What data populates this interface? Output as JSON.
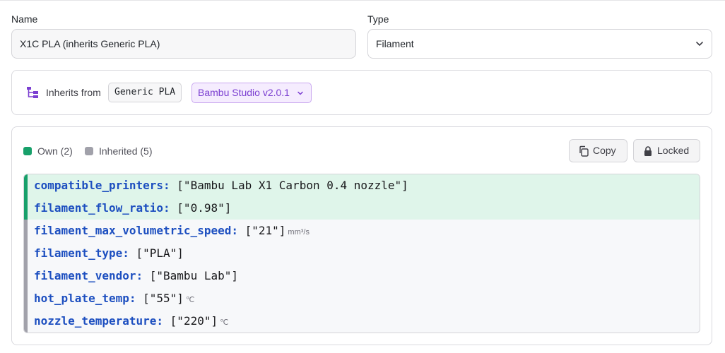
{
  "form": {
    "name_label": "Name",
    "name_value": "X1C PLA (inherits Generic PLA)",
    "type_label": "Type",
    "type_value": "Filament"
  },
  "inheritance": {
    "icon": "tree-icon",
    "label": "Inherits from",
    "parent": "Generic PLA",
    "version": "Bambu Studio v2.0.1"
  },
  "config": {
    "legend_own": "Own (2)",
    "legend_inherited": "Inherited (5)",
    "copy_label": "Copy",
    "locked_label": "Locked",
    "colors": {
      "own": "#17a06a",
      "inherited": "#a1a1aa",
      "key": "#1d4fc0"
    },
    "rows": [
      {
        "key": "compatible_printers:",
        "value": "[\"Bambu Lab X1 Carbon 0.4 nozzle\"]",
        "unit": "",
        "source": "own"
      },
      {
        "key": "filament_flow_ratio:",
        "value": "[\"0.98\"]",
        "unit": "",
        "source": "own"
      },
      {
        "key": "filament_max_volumetric_speed:",
        "value": "[\"21\"]",
        "unit": "mm³/s",
        "source": "inherited"
      },
      {
        "key": "filament_type:",
        "value": "[\"PLA\"]",
        "unit": "",
        "source": "inherited"
      },
      {
        "key": "filament_vendor:",
        "value": "[\"Bambu Lab\"]",
        "unit": "",
        "source": "inherited"
      },
      {
        "key": "hot_plate_temp:",
        "value": "[\"55\"]",
        "unit": "℃",
        "source": "inherited"
      },
      {
        "key": "nozzle_temperature:",
        "value": "[\"220\"]",
        "unit": "℃",
        "source": "inherited"
      }
    ]
  }
}
